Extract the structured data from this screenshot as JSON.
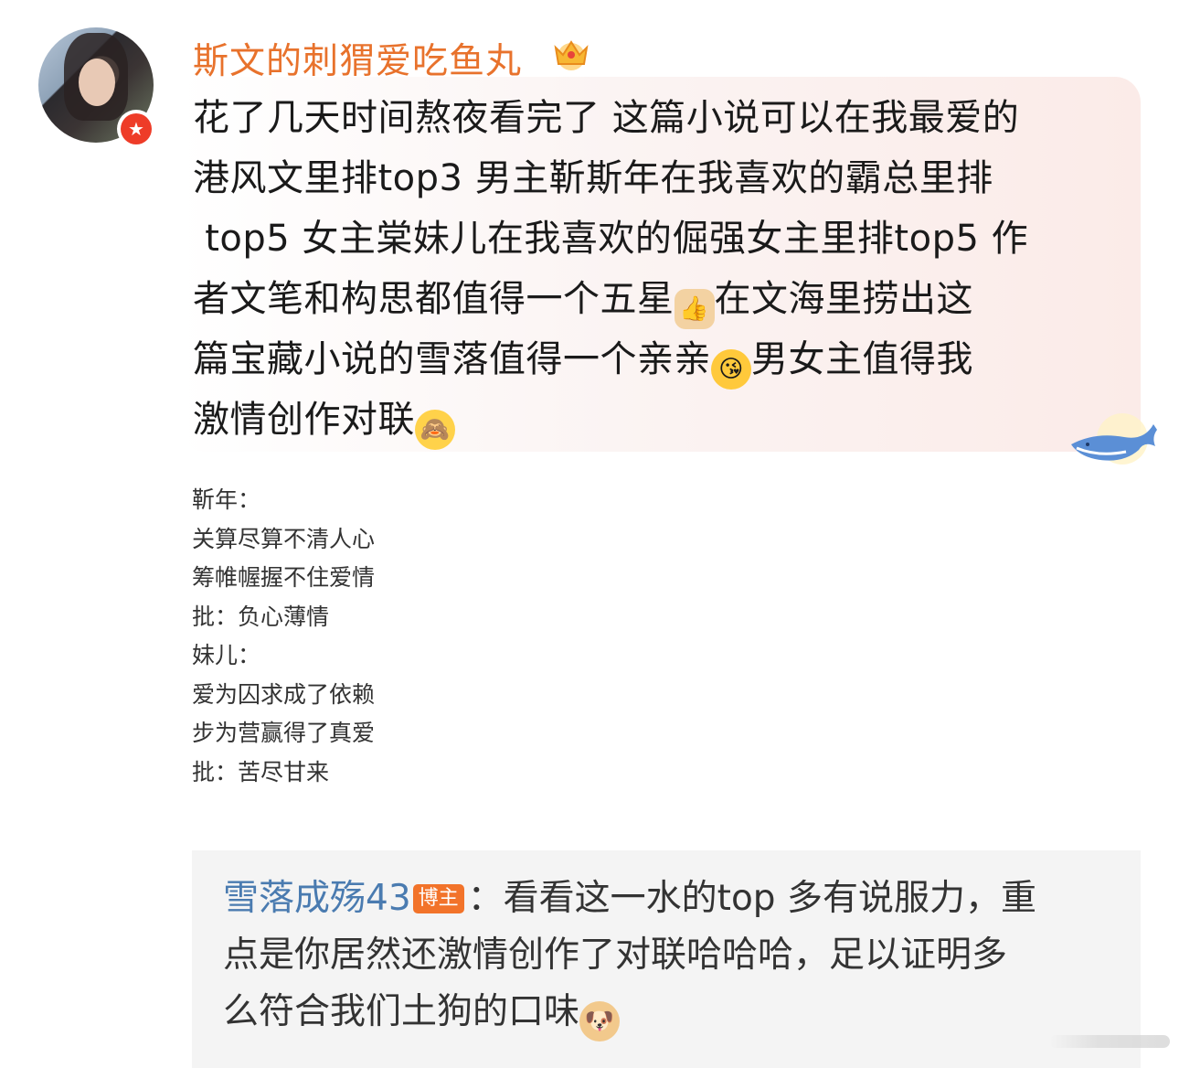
{
  "post": {
    "username": "斯文的刺猬爱吃鱼丸",
    "text_before_thumb": "花了几天时间熬夜看完了 这篇小说可以在我最爱的\n港风文里排top3 男主靳斯年在我喜欢的霸总里排\n top5 女主棠妹儿在我喜欢的倔强女主里排top5 作\n者文笔和构思都值得一个五星",
    "text_after_thumb": "在文海里捞出这\n篇宝藏小说的雪落值得一个亲亲",
    "text_after_kiss": "男女主值得我\n激情创作对联",
    "emojis": [
      "thumbs-up-icon",
      "kiss-face-icon",
      "cover-face-icon"
    ]
  },
  "couplet": {
    "lines": [
      "靳年：",
      "关算尽算不清人心",
      "筹帷幄握不住爱情",
      "批：负心薄情",
      "妹儿：",
      "爱为囚求成了依赖",
      "步为营赢得了真爱",
      "批：苦尽甘来"
    ]
  },
  "comment": {
    "author": "雪落成殇43",
    "badge": "博主",
    "text": "：看看这一水的top 多有说服力，重\n点是你居然还激情创作了对联哈哈哈，足以证明多\n么符合我们土狗的口味"
  },
  "colors": {
    "username": "#e8722c",
    "commenter": "#4a7bb0",
    "badge": "#f2732a",
    "verified": "#ee3c28",
    "bubble": "#fbebe8",
    "comment_bg": "#f4f4f4"
  }
}
